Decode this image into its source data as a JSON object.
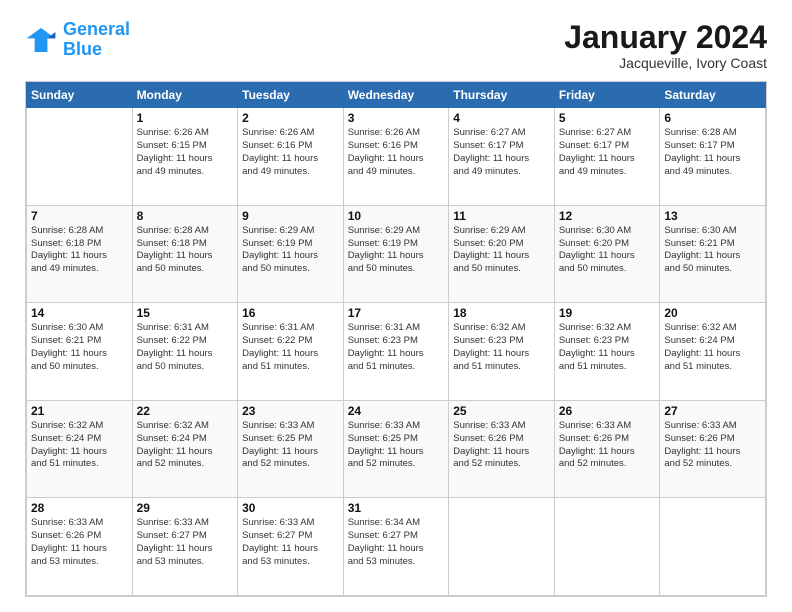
{
  "logo": {
    "line1": "General",
    "line2": "Blue"
  },
  "title": "January 2024",
  "location": "Jacqueville, Ivory Coast",
  "days_of_week": [
    "Sunday",
    "Monday",
    "Tuesday",
    "Wednesday",
    "Thursday",
    "Friday",
    "Saturday"
  ],
  "weeks": [
    [
      {
        "num": "",
        "info": ""
      },
      {
        "num": "1",
        "info": "Sunrise: 6:26 AM\nSunset: 6:15 PM\nDaylight: 11 hours\nand 49 minutes."
      },
      {
        "num": "2",
        "info": "Sunrise: 6:26 AM\nSunset: 6:16 PM\nDaylight: 11 hours\nand 49 minutes."
      },
      {
        "num": "3",
        "info": "Sunrise: 6:26 AM\nSunset: 6:16 PM\nDaylight: 11 hours\nand 49 minutes."
      },
      {
        "num": "4",
        "info": "Sunrise: 6:27 AM\nSunset: 6:17 PM\nDaylight: 11 hours\nand 49 minutes."
      },
      {
        "num": "5",
        "info": "Sunrise: 6:27 AM\nSunset: 6:17 PM\nDaylight: 11 hours\nand 49 minutes."
      },
      {
        "num": "6",
        "info": "Sunrise: 6:28 AM\nSunset: 6:17 PM\nDaylight: 11 hours\nand 49 minutes."
      }
    ],
    [
      {
        "num": "7",
        "info": "Sunrise: 6:28 AM\nSunset: 6:18 PM\nDaylight: 11 hours\nand 49 minutes."
      },
      {
        "num": "8",
        "info": "Sunrise: 6:28 AM\nSunset: 6:18 PM\nDaylight: 11 hours\nand 50 minutes."
      },
      {
        "num": "9",
        "info": "Sunrise: 6:29 AM\nSunset: 6:19 PM\nDaylight: 11 hours\nand 50 minutes."
      },
      {
        "num": "10",
        "info": "Sunrise: 6:29 AM\nSunset: 6:19 PM\nDaylight: 11 hours\nand 50 minutes."
      },
      {
        "num": "11",
        "info": "Sunrise: 6:29 AM\nSunset: 6:20 PM\nDaylight: 11 hours\nand 50 minutes."
      },
      {
        "num": "12",
        "info": "Sunrise: 6:30 AM\nSunset: 6:20 PM\nDaylight: 11 hours\nand 50 minutes."
      },
      {
        "num": "13",
        "info": "Sunrise: 6:30 AM\nSunset: 6:21 PM\nDaylight: 11 hours\nand 50 minutes."
      }
    ],
    [
      {
        "num": "14",
        "info": "Sunrise: 6:30 AM\nSunset: 6:21 PM\nDaylight: 11 hours\nand 50 minutes."
      },
      {
        "num": "15",
        "info": "Sunrise: 6:31 AM\nSunset: 6:22 PM\nDaylight: 11 hours\nand 50 minutes."
      },
      {
        "num": "16",
        "info": "Sunrise: 6:31 AM\nSunset: 6:22 PM\nDaylight: 11 hours\nand 51 minutes."
      },
      {
        "num": "17",
        "info": "Sunrise: 6:31 AM\nSunset: 6:23 PM\nDaylight: 11 hours\nand 51 minutes."
      },
      {
        "num": "18",
        "info": "Sunrise: 6:32 AM\nSunset: 6:23 PM\nDaylight: 11 hours\nand 51 minutes."
      },
      {
        "num": "19",
        "info": "Sunrise: 6:32 AM\nSunset: 6:23 PM\nDaylight: 11 hours\nand 51 minutes."
      },
      {
        "num": "20",
        "info": "Sunrise: 6:32 AM\nSunset: 6:24 PM\nDaylight: 11 hours\nand 51 minutes."
      }
    ],
    [
      {
        "num": "21",
        "info": "Sunrise: 6:32 AM\nSunset: 6:24 PM\nDaylight: 11 hours\nand 51 minutes."
      },
      {
        "num": "22",
        "info": "Sunrise: 6:32 AM\nSunset: 6:24 PM\nDaylight: 11 hours\nand 52 minutes."
      },
      {
        "num": "23",
        "info": "Sunrise: 6:33 AM\nSunset: 6:25 PM\nDaylight: 11 hours\nand 52 minutes."
      },
      {
        "num": "24",
        "info": "Sunrise: 6:33 AM\nSunset: 6:25 PM\nDaylight: 11 hours\nand 52 minutes."
      },
      {
        "num": "25",
        "info": "Sunrise: 6:33 AM\nSunset: 6:26 PM\nDaylight: 11 hours\nand 52 minutes."
      },
      {
        "num": "26",
        "info": "Sunrise: 6:33 AM\nSunset: 6:26 PM\nDaylight: 11 hours\nand 52 minutes."
      },
      {
        "num": "27",
        "info": "Sunrise: 6:33 AM\nSunset: 6:26 PM\nDaylight: 11 hours\nand 52 minutes."
      }
    ],
    [
      {
        "num": "28",
        "info": "Sunrise: 6:33 AM\nSunset: 6:26 PM\nDaylight: 11 hours\nand 53 minutes."
      },
      {
        "num": "29",
        "info": "Sunrise: 6:33 AM\nSunset: 6:27 PM\nDaylight: 11 hours\nand 53 minutes."
      },
      {
        "num": "30",
        "info": "Sunrise: 6:33 AM\nSunset: 6:27 PM\nDaylight: 11 hours\nand 53 minutes."
      },
      {
        "num": "31",
        "info": "Sunrise: 6:34 AM\nSunset: 6:27 PM\nDaylight: 11 hours\nand 53 minutes."
      },
      {
        "num": "",
        "info": ""
      },
      {
        "num": "",
        "info": ""
      },
      {
        "num": "",
        "info": ""
      }
    ]
  ]
}
